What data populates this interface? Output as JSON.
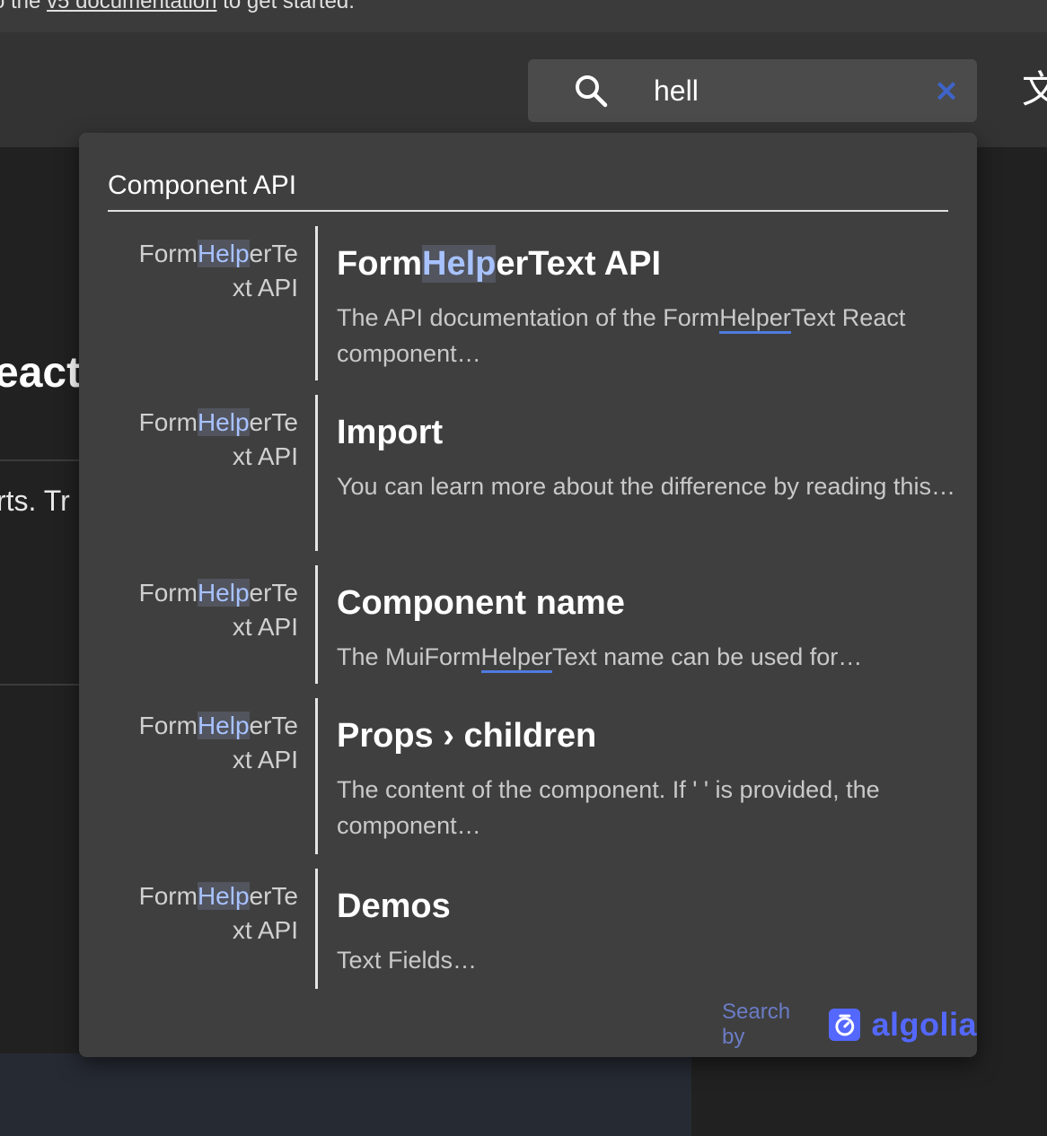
{
  "banner": {
    "prefix": "o the ",
    "link": "v5 documentation",
    "suffix": " to get started."
  },
  "search": {
    "value": "hell",
    "placeholder": ""
  },
  "background": {
    "react_fragment": "eact",
    "arts_fragment": "rts. Tr"
  },
  "dropdown": {
    "section_title": "Component API",
    "hits": [
      {
        "left_pre": "Form",
        "left_hl": "Help",
        "left_post": "erTe",
        "left_line2": "xt API",
        "title_pre": "Form",
        "title_hl": "Help",
        "title_post": "erText API",
        "text_pre": "The API documentation of the Form",
        "text_ul": "Help",
        "text_ul2": "er",
        "text_post": "Text React component…"
      },
      {
        "left_pre": "Form",
        "left_hl": "Help",
        "left_post": "erTe",
        "left_line2": "xt API",
        "title": "Import",
        "text": "You can learn more about the difference by reading this…"
      },
      {
        "left_pre": "Form",
        "left_hl": "Help",
        "left_post": "erTe",
        "left_line2": "xt API",
        "title": "Component name",
        "text_pre": "The MuiForm",
        "text_ul": "Help",
        "text_ul2": "er",
        "text_post": "Text name can be used for…"
      },
      {
        "left_pre": "Form",
        "left_hl": "Help",
        "left_post": "erTe",
        "left_line2": "xt API",
        "title": "Props › children",
        "text": "The content of the component. If ' ' is provided, the component…"
      },
      {
        "left_pre": "Form",
        "left_hl": "Help",
        "left_post": "erTe",
        "left_line2": "xt API",
        "title": "Demos",
        "text": "Text Fields…"
      }
    ],
    "footer": {
      "search_by": "Search by",
      "brand": "algolia"
    }
  },
  "colors": {
    "highlight_text": "#a7c2ff",
    "underline": "#4f7be0",
    "algolia": "#5468ff",
    "clear_icon": "#3f64c8"
  },
  "icons": {
    "search": "search-icon",
    "clear": "close-icon",
    "language": "translate-icon",
    "algolia": "algolia-logo-icon"
  }
}
